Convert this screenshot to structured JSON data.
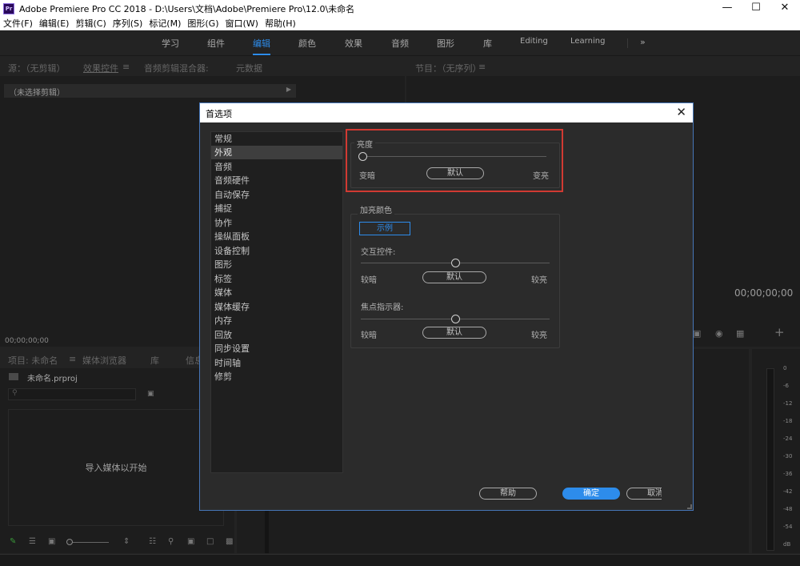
{
  "window": {
    "app_icon": "Pr",
    "title": "Adobe Premiere Pro CC 2018 - D:\\Users\\文档\\Adobe\\Premiere Pro\\12.0\\未命名",
    "minimize_icon": "minimize-icon",
    "maximize_icon": "maximize-icon",
    "close_icon": "close-icon"
  },
  "menu": [
    "文件(F)",
    "编辑(E)",
    "剪辑(C)",
    "序列(S)",
    "标记(M)",
    "图形(G)",
    "窗口(W)",
    "帮助(H)"
  ],
  "workspaces": {
    "items": [
      "学习",
      "组件",
      "编辑",
      "颜色",
      "效果",
      "音频",
      "图形",
      "库",
      "Editing",
      "Learning"
    ],
    "active": "编辑",
    "overflow": "»"
  },
  "source_panel": {
    "tabs": [
      "源：（无剪辑）",
      "效果控件",
      "音频剪辑混合器:",
      "元数据"
    ],
    "menu_icon": "≡",
    "no_clip": "（未选择剪辑）",
    "arrow": "▶",
    "timecode": "00;00;00;00"
  },
  "program_panel": {
    "title": "节目：（无序列）",
    "menu_icon": "≡",
    "timecode": "00;00;00;00",
    "add": "+"
  },
  "project_panel": {
    "tabs": [
      "项目: 未命名",
      "媒体浏览器",
      "库",
      "信息"
    ],
    "menu_icon": "≡",
    "file": "未命名.prproj",
    "import_hint": "导入媒体以开始"
  },
  "meter": {
    "ticks": [
      "0",
      "-6",
      "-12",
      "-18",
      "-24",
      "-30",
      "-36",
      "-42",
      "-48",
      "-54",
      "dB"
    ]
  },
  "dialog": {
    "title": "首选项",
    "close": "✕",
    "categories": [
      "常规",
      "外观",
      "音频",
      "音频硬件",
      "自动保存",
      "捕捉",
      "协作",
      "操纵面板",
      "设备控制",
      "图形",
      "标签",
      "媒体",
      "媒体缓存",
      "内存",
      "回放",
      "同步设置",
      "时间轴",
      "修剪"
    ],
    "selected_category": "外观",
    "brightness": {
      "label": "亮度",
      "level": 0.0,
      "min_label": "变暗",
      "max_label": "变亮",
      "default_button": "默认"
    },
    "highlight_color": {
      "label": "加亮颜色",
      "sample": "示例",
      "interactive_controls": {
        "label": "交互控件:",
        "level": 0.5,
        "min_label": "较暗",
        "max_label": "较亮",
        "default_button": "默认"
      },
      "focus_indicators": {
        "label": "焦点指示器:",
        "level": 0.5,
        "min_label": "较暗",
        "max_label": "较亮",
        "default_button": "默认"
      }
    },
    "buttons": {
      "help": "帮助",
      "ok": "确定",
      "cancel": "取消"
    },
    "accent_color": "#2d8ceb",
    "highlight_frame_color": "#d13a32"
  }
}
